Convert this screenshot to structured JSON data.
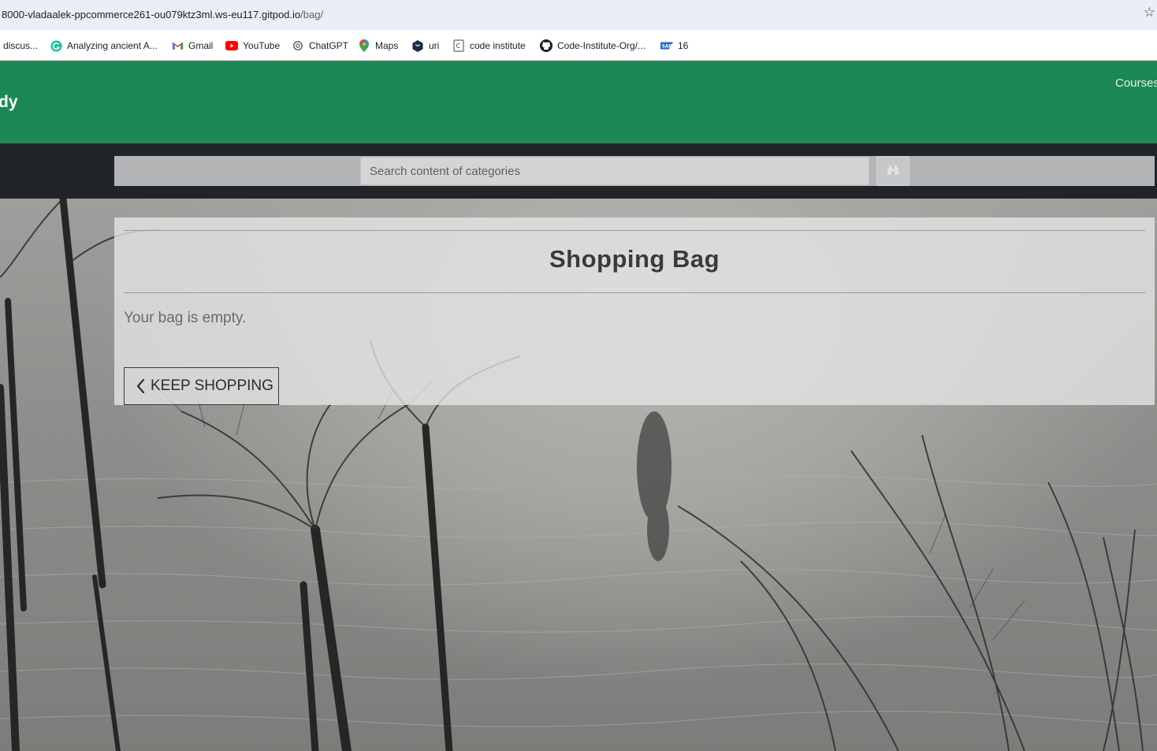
{
  "browser": {
    "url_host": "8000-vladaalek-ppcommerce261-ou079ktz3ml.ws-eu117.gitpod.io",
    "url_path": "/bag/",
    "bookmark_icon": "star-icon",
    "bookmarks": [
      {
        "label": "discus...",
        "icon": "none"
      },
      {
        "label": "Analyzing ancient A...",
        "icon": "grammarly-icon"
      },
      {
        "label": "Gmail",
        "icon": "gmail-icon"
      },
      {
        "label": "YouTube",
        "icon": "youtube-icon"
      },
      {
        "label": "ChatGPT",
        "icon": "chatgpt-icon"
      },
      {
        "label": "Maps",
        "icon": "maps-pin-icon"
      },
      {
        "label": "uri",
        "icon": "hexagon-icon"
      },
      {
        "label": "code institute",
        "icon": "page-icon"
      },
      {
        "label": "Code-Institute-Org/...",
        "icon": "github-icon"
      },
      {
        "label": "16",
        "icon": "sap-icon"
      }
    ]
  },
  "header": {
    "brand": "dy",
    "nav_courses": "Courses",
    "color": "#1c8854"
  },
  "search": {
    "placeholder": "Search content of categories",
    "button_icon": "binoculars-icon"
  },
  "main": {
    "title": "Shopping Bag",
    "empty_message": "Your bag is empty.",
    "keep_shopping": "KEEP SHOPPING",
    "keep_shopping_icon": "chevron-left-icon"
  }
}
